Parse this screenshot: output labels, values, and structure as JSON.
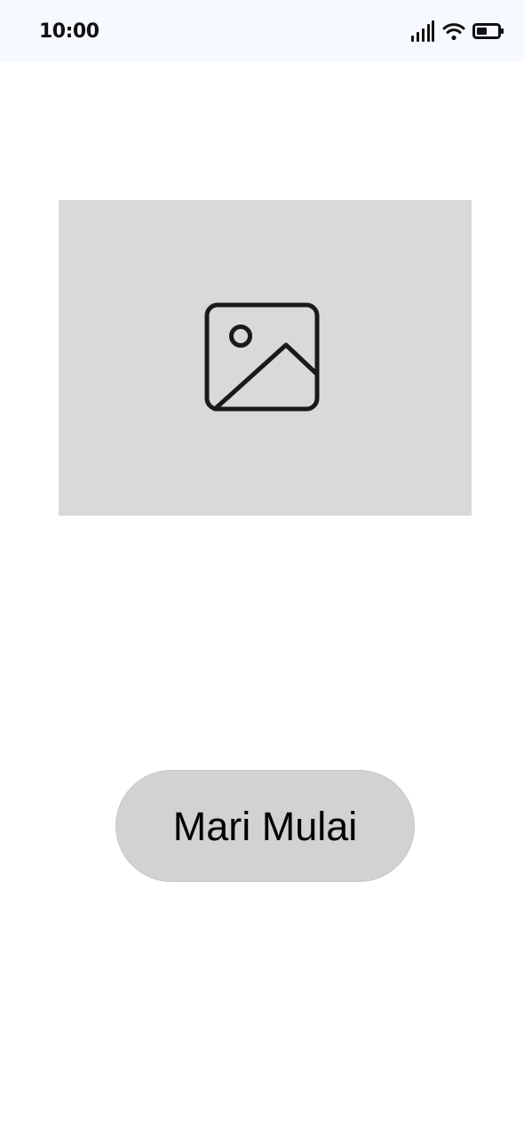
{
  "status_bar": {
    "time": "10:00",
    "icons": [
      "cellular-signal-icon",
      "wifi-icon",
      "battery-icon"
    ]
  },
  "hero": {
    "image_icon": "image-placeholder-icon"
  },
  "actions": {
    "start_label": "Mari Mulai"
  },
  "colors": {
    "status_bar_bg": "#f6f9ff",
    "placeholder_bg": "#d9d9d9",
    "button_bg": "#d3d1d3",
    "icon_stroke": "#1a1a1a"
  }
}
